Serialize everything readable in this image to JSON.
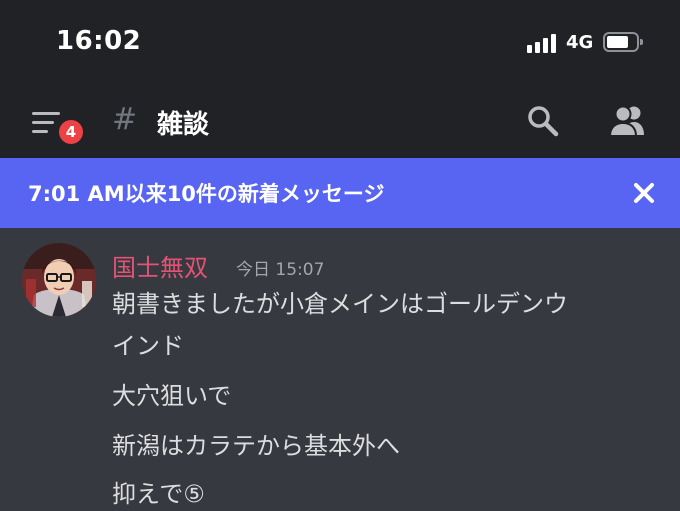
{
  "status_bar": {
    "time": "16:02",
    "network": "4G",
    "signal_bars": 4,
    "battery_level": 0.75
  },
  "header": {
    "menu_badge": "4",
    "channel_hash": "#",
    "channel_name": "雑談"
  },
  "banner": {
    "text": "7:01 AM以来10件の新着メッセージ",
    "color": "#5865f2"
  },
  "message": {
    "author": "国士無双",
    "author_color": "#e35374",
    "timestamp": "今日 15:07",
    "lines": [
      "朝書きましたが小倉メインはゴールデンウ",
      "インド",
      "大穴狙いで",
      "新潟はカラテから基本外へ",
      "抑えで⑤"
    ]
  },
  "icons": {
    "menu": "hamburger-menu-icon",
    "search": "search-icon",
    "members": "members-icon",
    "close": "close-icon"
  },
  "colors": {
    "background": "#36393f",
    "header_bg": "#202225",
    "badge": "#ed4245"
  }
}
